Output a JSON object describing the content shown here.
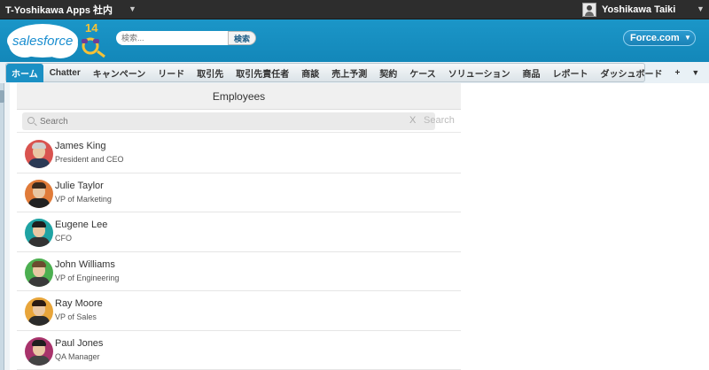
{
  "topbar": {
    "org_name": "T-Yoshikawa Apps 社内",
    "user_name": "Yoshikawa Taiki"
  },
  "header": {
    "logo_text": "salesforce",
    "logo_badge": "14",
    "search_placeholder": "検索...",
    "search_button": "検索",
    "app_switcher": "Force.com"
  },
  "tabs": [
    {
      "label": "ホーム",
      "active": true
    },
    {
      "label": "Chatter"
    },
    {
      "label": "キャンペーン"
    },
    {
      "label": "リード"
    },
    {
      "label": "取引先"
    },
    {
      "label": "取引先責任者"
    },
    {
      "label": "商談"
    },
    {
      "label": "売上予測"
    },
    {
      "label": "契約"
    },
    {
      "label": "ケース"
    },
    {
      "label": "ソリューション"
    },
    {
      "label": "商品"
    },
    {
      "label": "レポート"
    },
    {
      "label": "ダッシュボード"
    },
    {
      "label": "+"
    }
  ],
  "panel": {
    "title": "Employees",
    "search_placeholder": "Search",
    "clear_label": "X",
    "search_button": "Search"
  },
  "employees": [
    {
      "name": "James King",
      "title": "President and CEO",
      "ring": "#d9534f",
      "hair": "#cfcfcf",
      "suit": "#2b3a55"
    },
    {
      "name": "Julie Taylor",
      "title": "VP of Marketing",
      "ring": "#e07b39",
      "hair": "#3b2a1e",
      "suit": "#222222"
    },
    {
      "name": "Eugene Lee",
      "title": "CFO",
      "ring": "#1fa3a3",
      "hair": "#1e1e1e",
      "suit": "#333333"
    },
    {
      "name": "John Williams",
      "title": "VP of Engineering",
      "ring": "#4caf50",
      "hair": "#6b4b2e",
      "suit": "#3a3a3a"
    },
    {
      "name": "Ray Moore",
      "title": "VP of Sales",
      "ring": "#e8a53a",
      "hair": "#2b1b12",
      "suit": "#2b2b2b"
    },
    {
      "name": "Paul Jones",
      "title": "QA Manager",
      "ring": "#a8336b",
      "hair": "#1e1e1e",
      "suit": "#444444"
    }
  ]
}
